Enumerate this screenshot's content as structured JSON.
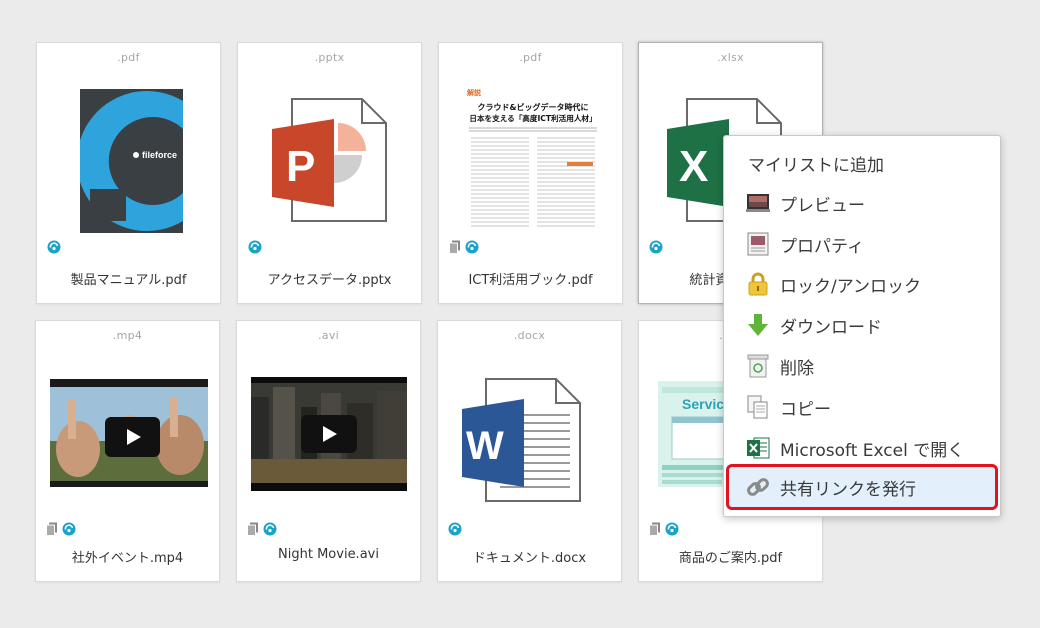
{
  "files": [
    {
      "ext": ".pdf",
      "name": "製品マニュアル.pdf"
    },
    {
      "ext": ".pptx",
      "name": "アクセスデータ.pptx"
    },
    {
      "ext": ".pdf",
      "name": "ICT利活用ブック.pdf"
    },
    {
      "ext": ".xlsx",
      "name": "統計資料.xlsx"
    },
    {
      "ext": ".mp4",
      "name": "社外イベント.mp4"
    },
    {
      "ext": ".avi",
      "name": "Night Movie.avi"
    },
    {
      "ext": ".docx",
      "name": "ドキュメント.docx"
    },
    {
      "ext": ".pdf",
      "name": "商品のご案内.pdf"
    }
  ],
  "thumbs": {
    "manual_brand": "fileforce",
    "doc_tag": "解説",
    "doc_title_1": "クラウド&ビッグデータ時代に",
    "doc_title_2": "日本を支える「高度ICT利活用人材」",
    "service_heading": "Servic",
    "ppt_letter": "P",
    "xls_letter": "X",
    "word_letter": "W"
  },
  "context_menu": {
    "items": [
      {
        "label": "マイリストに追加",
        "icon": "none"
      },
      {
        "label": "プレビュー",
        "icon": "preview-icon"
      },
      {
        "label": "プロパティ",
        "icon": "properties-icon"
      },
      {
        "label": "ロック/アンロック",
        "icon": "lock-icon"
      },
      {
        "label": "ダウンロード",
        "icon": "download-icon"
      },
      {
        "label": "削除",
        "icon": "trash-icon"
      },
      {
        "label": "コピー",
        "icon": "copy-icon"
      },
      {
        "label": "Microsoft Excel で開く",
        "icon": "excel-icon"
      },
      {
        "label": "共有リンクを発行",
        "icon": "link-icon",
        "highlighted": true
      }
    ]
  },
  "colors": {
    "background": "#ebebeb",
    "highlight_border": "#e0141e",
    "highlight_fill": "#e3f0fb",
    "sync_icon": "#1aa3c8"
  }
}
